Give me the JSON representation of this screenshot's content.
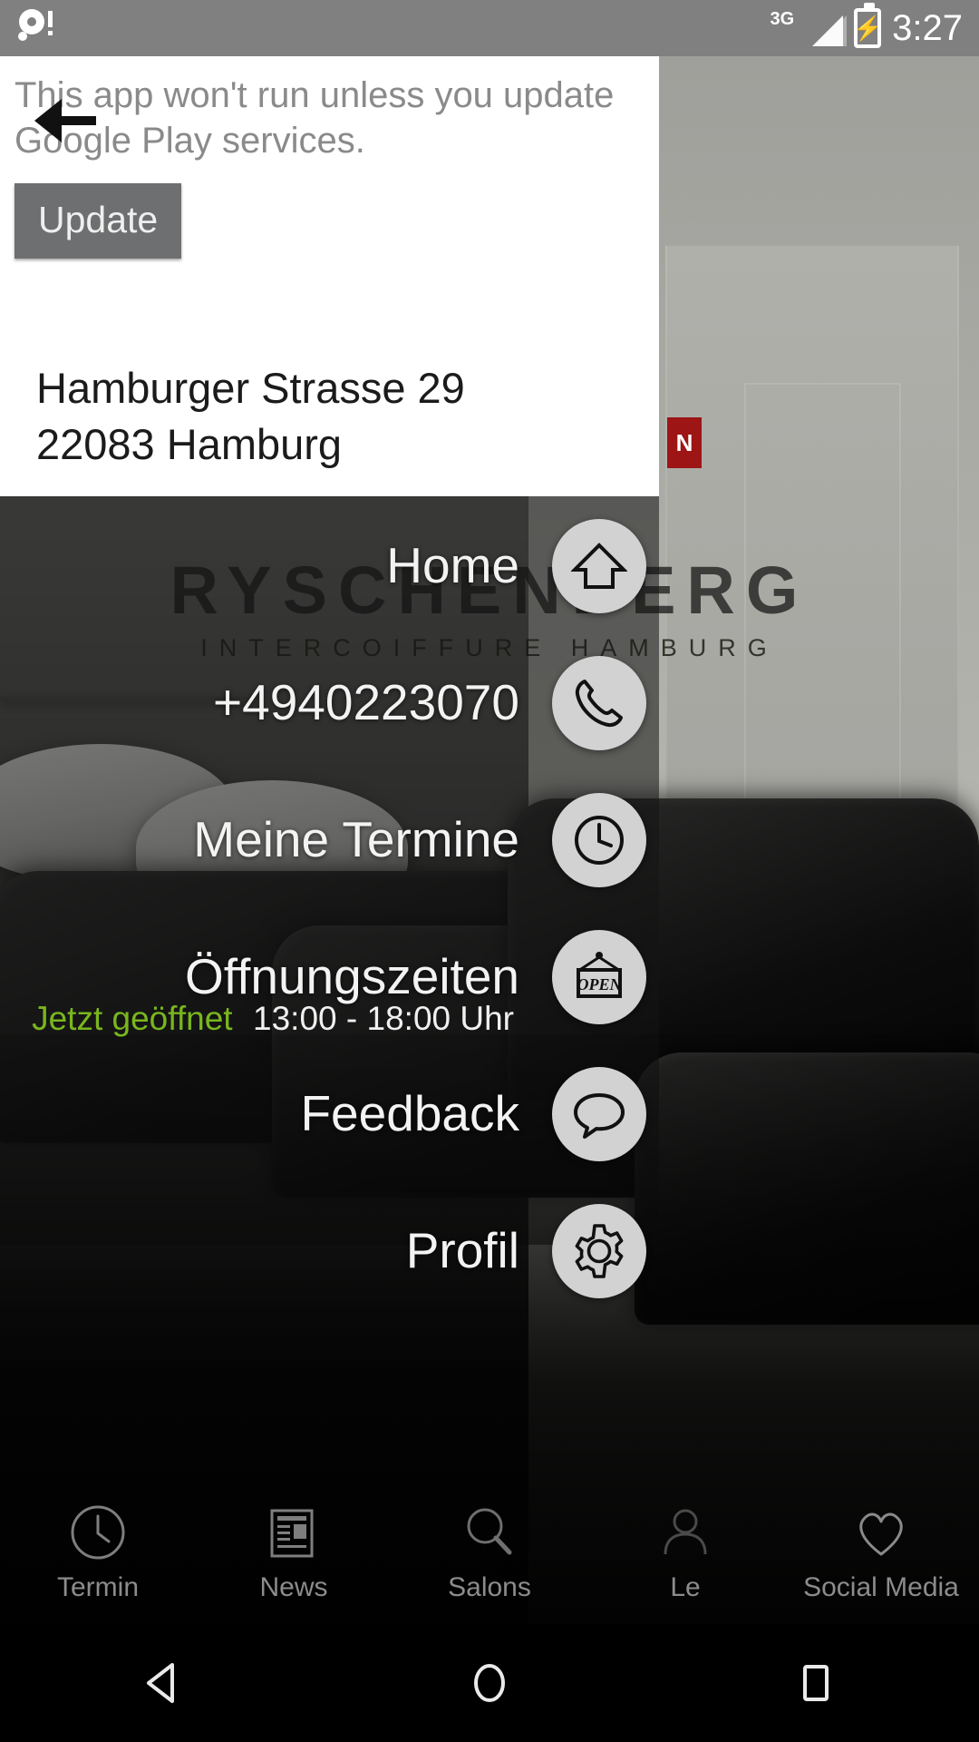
{
  "status_bar": {
    "notification_icon": "app-notification-icon",
    "network": "3G",
    "signal_icon": "signal-bars-icon",
    "battery_icon": "battery-charging-icon",
    "time": "3:27"
  },
  "play_services_banner": {
    "message": "This app won't run unless you update Google Play services.",
    "update_label": "Update"
  },
  "back_button": {
    "icon": "back-arrow-icon"
  },
  "address": {
    "line1": "Hamburger Strasse 29",
    "line2": "22083 Hamburg"
  },
  "brand": {
    "name": "RYSCHENBERG",
    "subtitle": "INTERCOIFFURE HAMBURG"
  },
  "menu": {
    "items": [
      {
        "label": "Home",
        "icon": "home-icon",
        "sub_open": "",
        "sub_time": ""
      },
      {
        "label": "+4940223070",
        "icon": "phone-icon",
        "sub_open": "",
        "sub_time": ""
      },
      {
        "label": "Meine Termine",
        "icon": "clock-icon",
        "sub_open": "",
        "sub_time": ""
      },
      {
        "label": "Öffnungszeiten",
        "icon": "open-sign-icon",
        "sub_open": "Jetzt geöffnet",
        "sub_time": "13:00 - 18:00 Uhr"
      },
      {
        "label": "Feedback",
        "icon": "speech-bubble-icon",
        "sub_open": "",
        "sub_time": ""
      },
      {
        "label": "Profil",
        "icon": "gear-icon",
        "sub_open": "",
        "sub_time": ""
      }
    ]
  },
  "tab_bar": {
    "items": [
      {
        "label": "Termin",
        "icon": "clock-icon"
      },
      {
        "label": "News",
        "icon": "newspaper-icon"
      },
      {
        "label": "Salons",
        "icon": "search-icon"
      },
      {
        "label": "Le",
        "icon": "person-icon"
      },
      {
        "label": "Social Media",
        "icon": "heart-icon"
      }
    ]
  },
  "nav_bar": {
    "back": "back-triangle-icon",
    "home": "home-circle-icon",
    "recents": "recents-square-icon"
  },
  "colors": {
    "status_bar_bg": "#808080",
    "open_green": "#79b61d",
    "update_button": "#6d6f70",
    "icon_circle": "#d2d2d2",
    "badge_red": "#9e1515"
  },
  "photo_badge": {
    "letter": "N"
  }
}
